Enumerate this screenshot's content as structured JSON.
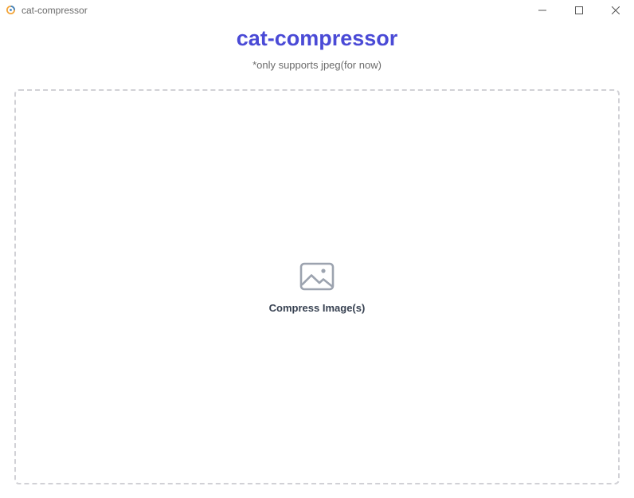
{
  "window": {
    "title": "cat-compressor",
    "controls": [
      "minimize-icon",
      "maximize-icon",
      "close-icon"
    ]
  },
  "header": {
    "title": "cat-compressor",
    "subtitle": "*only supports jpeg(for now)"
  },
  "dropzone": {
    "icon": "image-icon",
    "label": "Compress Image(s)"
  },
  "colors": {
    "title": "#4a4ad6",
    "subtitle": "#6b6b6b",
    "dropzone_border": "#d1d1d6",
    "icon": "#9ca3af",
    "label": "#374151"
  }
}
